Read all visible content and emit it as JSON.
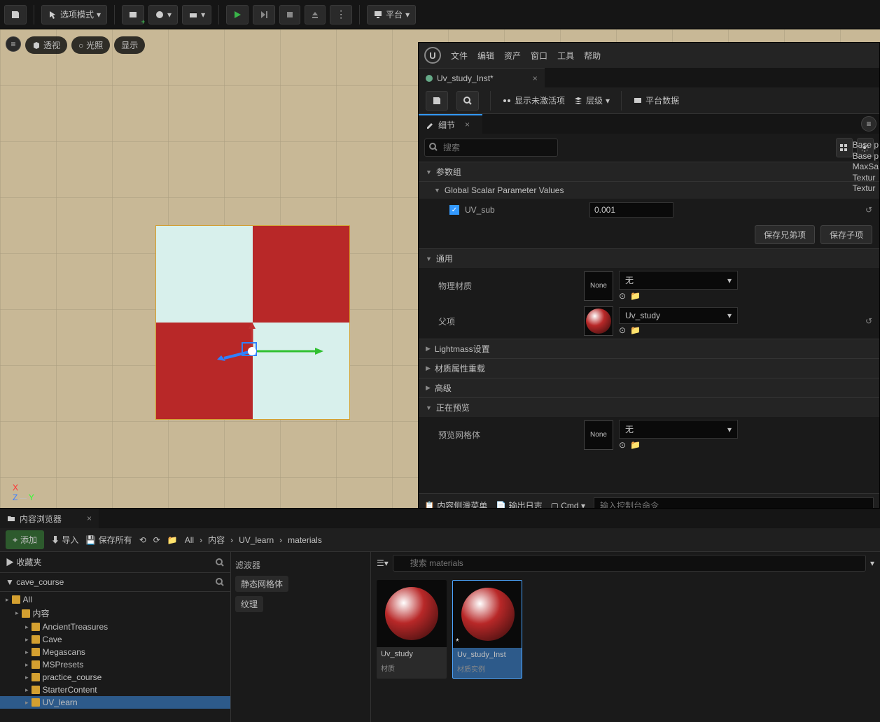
{
  "toolbar": {
    "save_icon": "save",
    "mode_label": "选项模式",
    "platform_label": "平台"
  },
  "viewport": {
    "overlays": [
      "透视",
      "光照",
      "显示"
    ],
    "axes": {
      "x": "X",
      "y": "Y",
      "z": "Z"
    }
  },
  "details_window": {
    "menus": [
      "文件",
      "编辑",
      "资产",
      "窗口",
      "工具",
      "帮助"
    ],
    "tab_title": "Uv_study_Inst*",
    "secondary_toolbar": {
      "show_inactive": "显示未激活项",
      "layers": "层级",
      "platform_data": "平台数据"
    },
    "details_tab": "细节",
    "search_placeholder": "搜索",
    "sections": {
      "param_group": "参数组",
      "global_scalar": "Global Scalar Parameter Values",
      "general": "通用",
      "lightmass": "Lightmass设置",
      "material_override": "材质属性重载",
      "advanced": "高级",
      "previewing": "正在预览"
    },
    "params": {
      "uv_sub_label": "UV_sub",
      "uv_sub_value": "0.001",
      "save_sibling": "保存兄弟项",
      "save_child": "保存子项",
      "phys_material": "物理材质",
      "parent": "父项",
      "preview_mesh": "预览网格体",
      "none": "None",
      "none_cn": "无",
      "parent_value": "Uv_study"
    },
    "footer": {
      "content_drawer": "内容侧滑菜单",
      "output_log": "输出日志",
      "cmd": "Cmd",
      "cmd_placeholder": "输入控制台命令"
    },
    "preview_text": [
      "Base p",
      "Base p",
      "MaxSa",
      "Textur",
      "Textur"
    ]
  },
  "content_browser": {
    "tab": "内容浏览器",
    "add": "添加",
    "import": "导入",
    "save_all": "保存所有",
    "breadcrumb": [
      "All",
      "内容",
      "UV_learn",
      "materials"
    ],
    "favorites": "收藏夹",
    "src_label": "cave_course",
    "tree": [
      {
        "label": "All",
        "depth": 0
      },
      {
        "label": "内容",
        "depth": 1
      },
      {
        "label": "AncientTreasures",
        "depth": 2
      },
      {
        "label": "Cave",
        "depth": 2
      },
      {
        "label": "Megascans",
        "depth": 2
      },
      {
        "label": "MSPresets",
        "depth": 2
      },
      {
        "label": "practice_course",
        "depth": 2
      },
      {
        "label": "StarterContent",
        "depth": 2
      },
      {
        "label": "UV_learn",
        "depth": 2,
        "sel": true
      }
    ],
    "filter_label": "滤波器",
    "filters": [
      "静态网格体",
      "纹理"
    ],
    "asset_search_placeholder": "搜索 materials",
    "assets": [
      {
        "name": "Uv_study",
        "type": "材质",
        "sel": false
      },
      {
        "name": "Uv_study_Inst",
        "type": "材质实例",
        "sel": true
      }
    ]
  }
}
